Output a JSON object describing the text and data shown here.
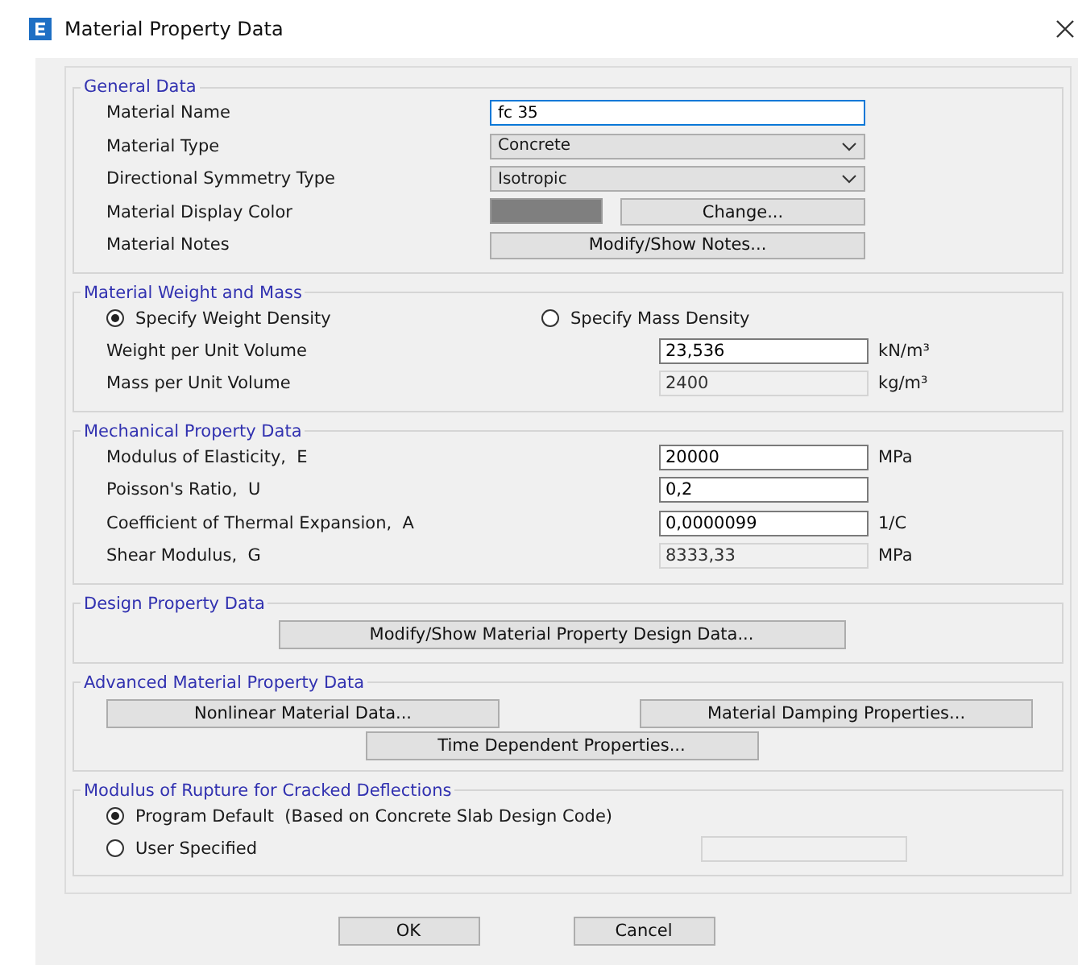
{
  "window": {
    "title": "Material Property Data"
  },
  "general": {
    "title": "General Data",
    "rows": [
      {
        "kind": "text",
        "label": "Material Name",
        "value": "fc 35"
      },
      {
        "kind": "dropdown",
        "label": "Material Type",
        "value": "Concrete"
      },
      {
        "kind": "dropdown",
        "label": "Directional Symmetry Type",
        "value": "Isotropic"
      },
      {
        "kind": "color",
        "label": "Material Display Color",
        "color": "#7f7f7f",
        "button": "Change..."
      },
      {
        "kind": "button",
        "label": "Material Notes",
        "button": "Modify/Show Notes..."
      }
    ]
  },
  "weight_mass": {
    "title": "Material Weight and Mass",
    "radios": [
      {
        "label": "Specify Weight Density",
        "selected": true
      },
      {
        "label": "Specify Mass Density",
        "selected": false
      }
    ],
    "fields": [
      {
        "label": "Weight per Unit Volume",
        "value": "23,536",
        "unit": "kN/m³",
        "disabled": false
      },
      {
        "label": "Mass per Unit Volume",
        "value": "2400",
        "unit": "kg/m³",
        "disabled": true
      }
    ]
  },
  "mechanical": {
    "title": "Mechanical Property Data",
    "fields": [
      {
        "label": "Modulus of Elasticity,  E",
        "value": "20000",
        "unit": "MPa",
        "disabled": false
      },
      {
        "label": "Poisson's Ratio,  U",
        "value": "0,2",
        "disabled": false
      },
      {
        "label": "Coefficient of Thermal Expansion,  A",
        "value": "0,0000099",
        "unit": "1/C",
        "disabled": false
      },
      {
        "label": "Shear Modulus,  G",
        "value": "8333,33",
        "unit": "MPa",
        "disabled": true
      }
    ]
  },
  "design": {
    "title": "Design Property Data",
    "button": "Modify/Show Material Property Design Data..."
  },
  "advanced": {
    "title": "Advanced Material Property Data",
    "buttons": [
      "Nonlinear Material Data...",
      "Material Damping Properties...",
      "Time Dependent Properties..."
    ]
  },
  "rupture": {
    "title": "Modulus of Rupture for Cracked Deflections",
    "options": [
      {
        "label": "Program Default  (Based on Concrete Slab Design Code)",
        "selected": true
      },
      {
        "label": "User Specified",
        "selected": false
      }
    ],
    "field": {
      "disabled": true
    }
  },
  "buttons": [
    "OK",
    "Cancel"
  ]
}
